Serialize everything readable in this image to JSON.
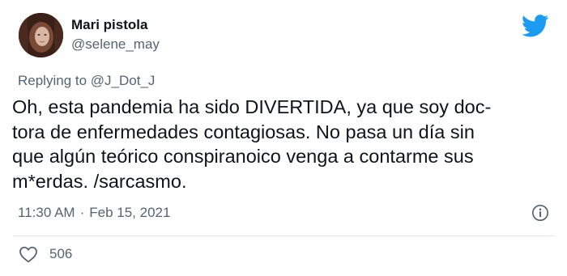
{
  "user": {
    "display_name": "Mari pistola",
    "handle": "@selene_may"
  },
  "reply": {
    "prefix": "Replying to ",
    "mention": "@J_Dot_J"
  },
  "tweet": {
    "text": "Oh, esta pandemia ha sido DIVERTIDA, ya que soy doc-\ntora de enfermedades contagiosas. No pasa un día sin\nque algún teórico conspiranoico venga a contarme sus\nm*erdas. /sarcasmo.",
    "time": "11:30 AM",
    "separator": "·",
    "date": "Feb 15, 2021",
    "likes": "506"
  },
  "icons": {
    "brand": "twitter-bird-icon",
    "info": "info-icon",
    "like": "heart-icon"
  },
  "colors": {
    "brand_blue": "#1d9bf0",
    "secondary_text": "#536471",
    "primary_text": "#0f1419"
  }
}
